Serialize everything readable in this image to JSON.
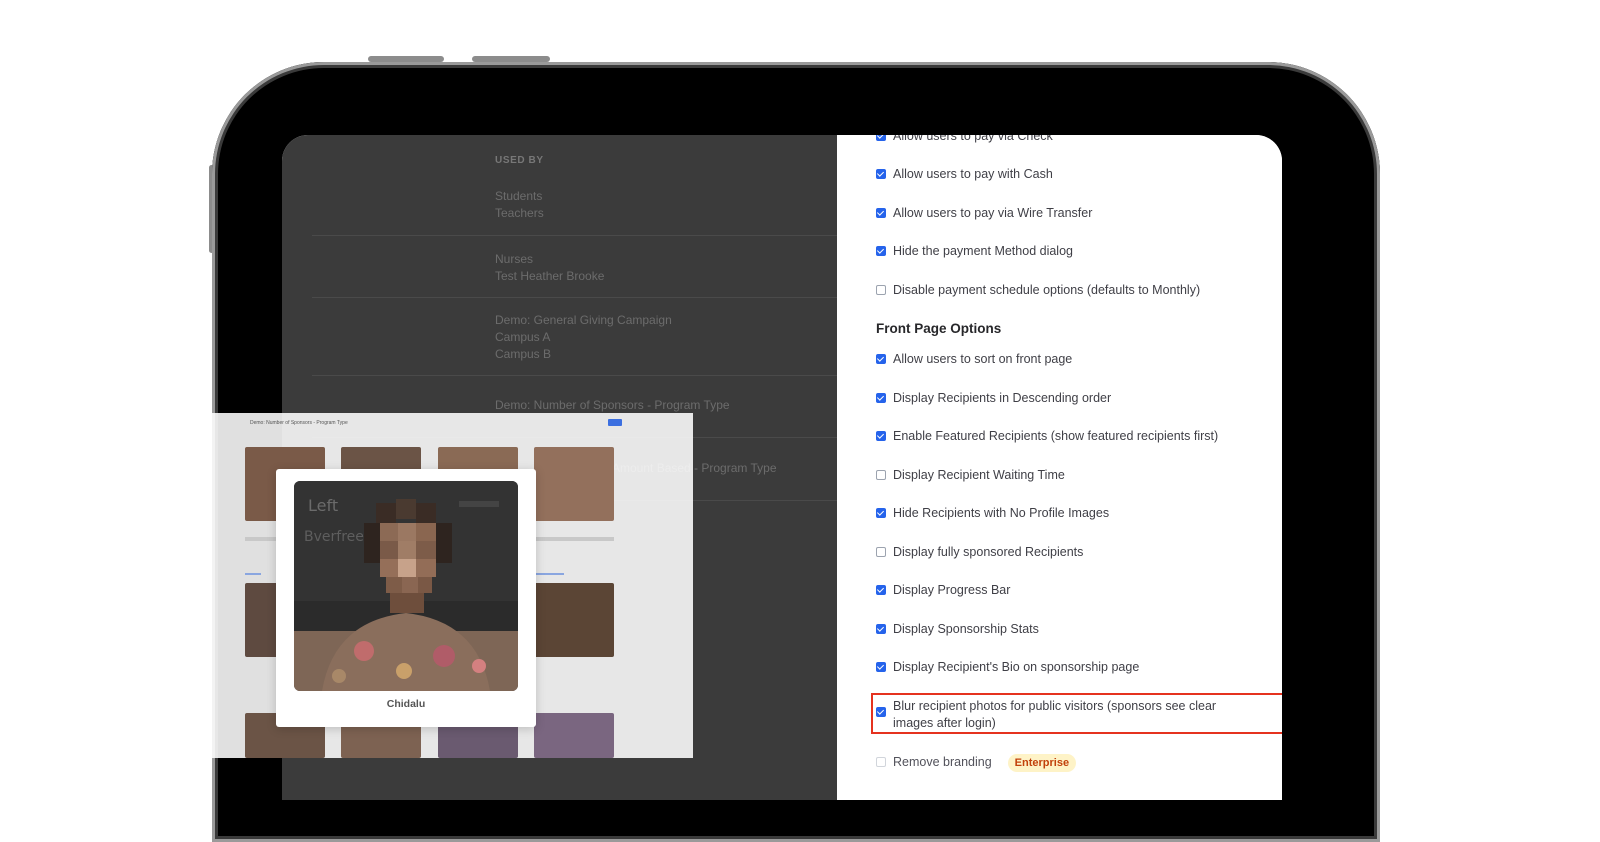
{
  "background_page": {
    "header": "USED BY",
    "rows": [
      [
        "Students",
        "Teachers"
      ],
      [
        "Nurses",
        "Test Heather Brooke"
      ],
      [
        "Demo: General Giving Campaign",
        "Campus A",
        "Campus B"
      ],
      [
        "Demo: Number of Sponsors - Program Type"
      ],
      [
        "Amount Based - Program Type"
      ]
    ]
  },
  "settings": {
    "payment_options": [
      {
        "label": "Allow users to pay via Check",
        "checked": true
      },
      {
        "label": "Allow users to pay with Cash",
        "checked": true
      },
      {
        "label": "Allow users to pay via Wire Transfer",
        "checked": true
      },
      {
        "label": "Hide the payment Method dialog",
        "checked": true
      },
      {
        "label": "Disable payment schedule options (defaults to Monthly)",
        "checked": false
      }
    ],
    "front_page_title": "Front Page Options",
    "front_page_options": [
      {
        "label": "Allow users to sort on front page",
        "checked": true
      },
      {
        "label": "Display Recipients in Descending order",
        "checked": true
      },
      {
        "label": "Enable Featured Recipients (show featured recipients first)",
        "checked": true
      },
      {
        "label": "Display Recipient Waiting Time",
        "checked": false
      },
      {
        "label": "Hide Recipients with No Profile Images",
        "checked": true
      },
      {
        "label": "Display fully sponsored Recipients",
        "checked": false
      },
      {
        "label": "Display Progress Bar",
        "checked": true
      },
      {
        "label": "Display Sponsorship Stats",
        "checked": true
      },
      {
        "label": "Display Recipient's Bio on sponsorship page",
        "checked": true
      },
      {
        "label": "Blur recipient photos for public visitors (sponsors see clear images after login)",
        "checked": true
      },
      {
        "label": "Remove branding",
        "checked": false
      }
    ],
    "remove_branding_badge": "Enterprise"
  },
  "overlay": {
    "mini_page_title": "Demo: Number of Sponsors - Program Type",
    "card_name": "Chidalu"
  },
  "colors": {
    "accent": "#2563eb",
    "highlight": "#e5321f",
    "badge_bg": "#fef3c7",
    "badge_text": "#c2410c"
  }
}
